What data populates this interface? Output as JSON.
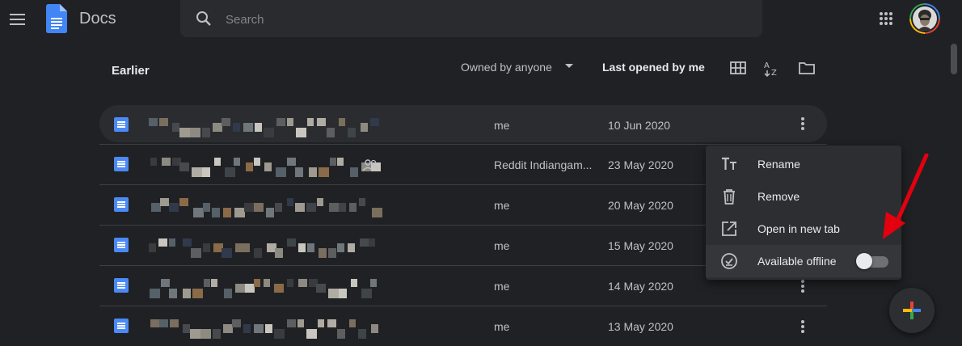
{
  "app": {
    "title": "Docs",
    "search_placeholder": "Search",
    "accent": "#4b8af4"
  },
  "header_icons": [
    "menu-icon",
    "docs-logo-icon",
    "search-icon",
    "apps-grid-icon",
    "avatar"
  ],
  "list": {
    "section_title": "Earlier",
    "owner_filter": "Owned by anyone",
    "sort_label": "Last opened by me",
    "view_icons": [
      "grid-view-icon",
      "sort-az-icon",
      "folder-icon"
    ],
    "rows": [
      {
        "owner": "me",
        "date": "10 Jun 2020",
        "selected": true,
        "shared": false
      },
      {
        "owner": "Reddit Indiangam...",
        "date": "23 May 2020",
        "selected": false,
        "shared": true
      },
      {
        "owner": "me",
        "date": "20 May 2020",
        "selected": false,
        "shared": false
      },
      {
        "owner": "me",
        "date": "15 May 2020",
        "selected": false,
        "shared": false
      },
      {
        "owner": "me",
        "date": "14 May 2020",
        "selected": false,
        "shared": false
      },
      {
        "owner": "me",
        "date": "13 May 2020",
        "selected": false,
        "shared": false
      }
    ]
  },
  "context_menu": {
    "items": [
      {
        "label": "Rename",
        "icon": "text-format-icon"
      },
      {
        "label": "Remove",
        "icon": "trash-icon"
      },
      {
        "label": "Open in new tab",
        "icon": "open-in-new-icon"
      },
      {
        "label": "Available offline",
        "icon": "offline-check-icon",
        "toggle": false
      }
    ]
  },
  "annotation": {
    "arrow_color": "#e3000f"
  },
  "fab": {
    "icon": "plus-icon"
  }
}
